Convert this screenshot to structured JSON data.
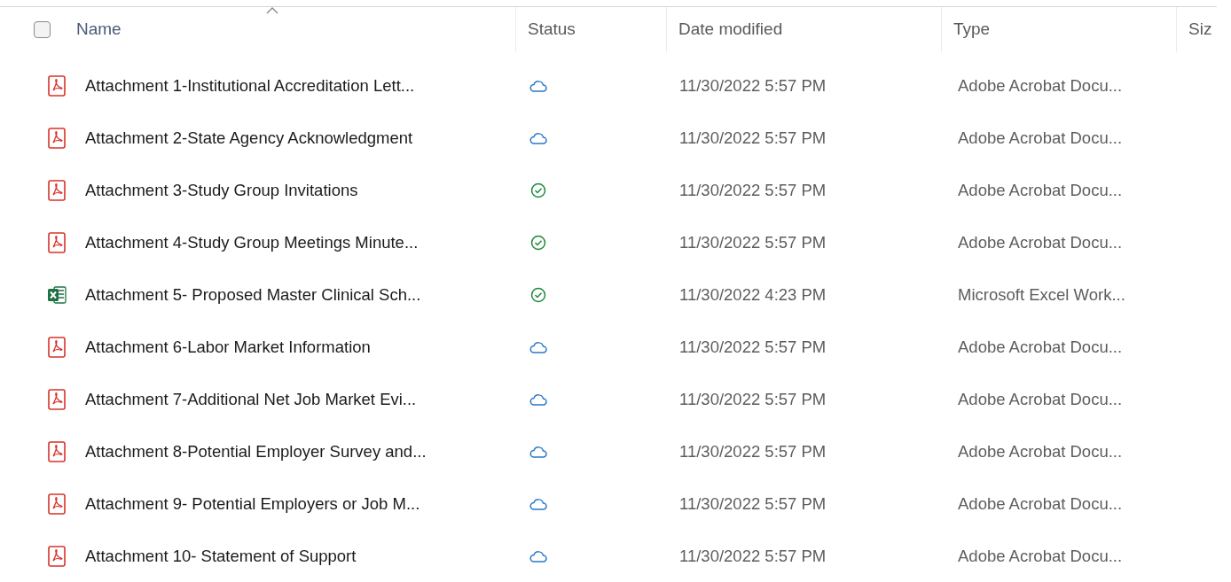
{
  "header": {
    "select_all": {
      "checked": false
    },
    "columns": [
      {
        "label": "Name",
        "sorted": true
      },
      {
        "label": "Status",
        "sorted": false
      },
      {
        "label": "Date modified",
        "sorted": false
      },
      {
        "label": "Type",
        "sorted": false
      },
      {
        "label": "Siz",
        "sorted": false
      }
    ]
  },
  "rows": [
    {
      "kind": "pdf",
      "name": "Attachment 1-Institutional Accreditation Lett...",
      "status": {
        "kind": "cloud"
      },
      "date": "11/30/2022 5:57 PM",
      "type": "Adobe Acrobat Docu..."
    },
    {
      "kind": "pdf",
      "name": "Attachment 2-State Agency Acknowledgment",
      "status": {
        "kind": "cloud"
      },
      "date": "11/30/2022 5:57 PM",
      "type": "Adobe Acrobat Docu..."
    },
    {
      "kind": "pdf",
      "name": "Attachment 3-Study Group Invitations",
      "status": {
        "kind": "synced"
      },
      "date": "11/30/2022 5:57 PM",
      "type": "Adobe Acrobat Docu..."
    },
    {
      "kind": "pdf",
      "name": "Attachment 4-Study Group Meetings Minute...",
      "status": {
        "kind": "synced"
      },
      "date": "11/30/2022 5:57 PM",
      "type": "Adobe Acrobat Docu..."
    },
    {
      "kind": "excel",
      "name": "Attachment 5- Proposed Master Clinical Sch...",
      "status": {
        "kind": "synced"
      },
      "date": "11/30/2022 4:23 PM",
      "type": "Microsoft Excel Work..."
    },
    {
      "kind": "pdf",
      "name": "Attachment 6-Labor Market Information",
      "status": {
        "kind": "cloud"
      },
      "date": "11/30/2022 5:57 PM",
      "type": "Adobe Acrobat Docu..."
    },
    {
      "kind": "pdf",
      "name": "Attachment 7-Additional Net Job Market Evi...",
      "status": {
        "kind": "cloud"
      },
      "date": "11/30/2022 5:57 PM",
      "type": "Adobe Acrobat Docu..."
    },
    {
      "kind": "pdf",
      "name": "Attachment 8-Potential Employer Survey and...",
      "status": {
        "kind": "cloud"
      },
      "date": "11/30/2022 5:57 PM",
      "type": "Adobe Acrobat Docu..."
    },
    {
      "kind": "pdf",
      "name": "Attachment 9- Potential Employers or Job M...",
      "status": {
        "kind": "cloud"
      },
      "date": "11/30/2022 5:57 PM",
      "type": "Adobe Acrobat Docu..."
    },
    {
      "kind": "pdf",
      "name": "Attachment 10- Statement of Support",
      "status": {
        "kind": "cloud"
      },
      "date": "11/30/2022 5:57 PM",
      "type": "Adobe Acrobat Docu..."
    }
  ]
}
